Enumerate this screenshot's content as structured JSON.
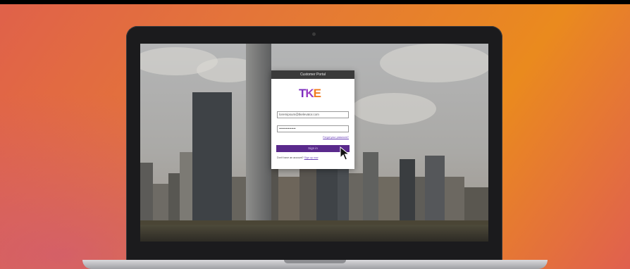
{
  "modal": {
    "title": "Customer Portal",
    "logo_text": {
      "t": "T",
      "k": "K",
      "e": "E"
    },
    "email_value": "loremipsum@tkelevator.com",
    "password_value": "•••••••••••••••",
    "forgot_label": "Forgot your password?",
    "signin_label": "Sign in",
    "no_account_text": "Don't have an account?",
    "signup_label": "Sign up now"
  },
  "colors": {
    "brand_purple": "#5a2a8c",
    "brand_orange": "#f07d1e",
    "background_orange": "#ea8a1e"
  }
}
